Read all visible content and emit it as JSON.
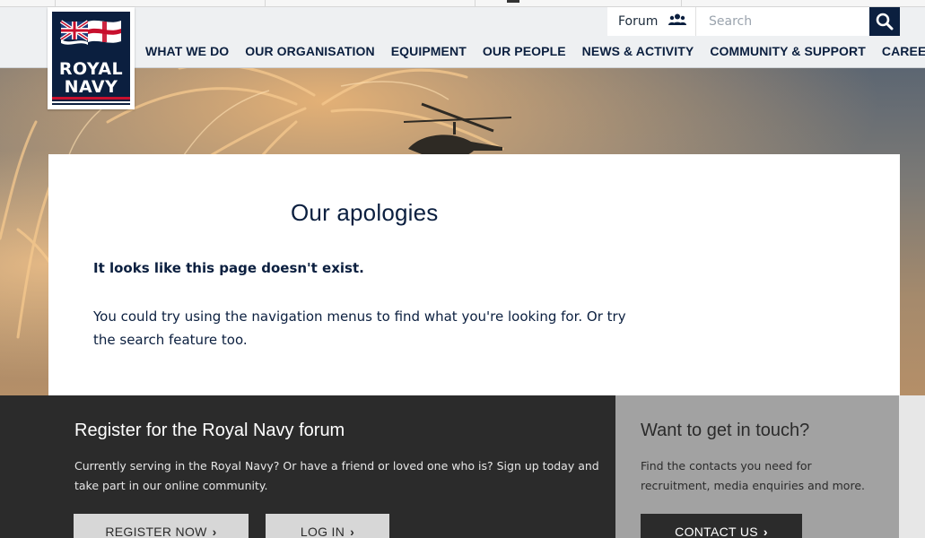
{
  "brand": {
    "logo_line1": "ROYAL",
    "logo_line2": "NAVY",
    "navy": "#0b1f3f",
    "red": "#c8102e"
  },
  "utility": {
    "forum_label": "Forum",
    "forum_icon": "users-icon",
    "search_placeholder": "Search",
    "search_icon": "search-icon"
  },
  "nav": {
    "items": [
      "WHAT WE DO",
      "OUR ORGANISATION",
      "EQUIPMENT",
      "OUR PEOPLE",
      "NEWS & ACTIVITY",
      "COMMUNITY & SUPPORT",
      "CAREERS"
    ]
  },
  "error": {
    "title": "Our apologies",
    "lead": "It looks like this page doesn't exist.",
    "body": "You could try using the navigation menus to find what you're looking for. Or try the search feature too."
  },
  "forum_panel": {
    "title": "Register for the Royal Navy forum",
    "text": "Currently serving in the Royal Navy? Or have a friend or loved one who is? Sign up today and take part in our online community.",
    "register_label": "REGISTER NOW",
    "login_label": "LOG IN"
  },
  "contact_panel": {
    "title": "Want to get in touch?",
    "text": "Find the contacts you need for recruitment, media enquiries and more.",
    "contact_label": "CONTACT US"
  }
}
